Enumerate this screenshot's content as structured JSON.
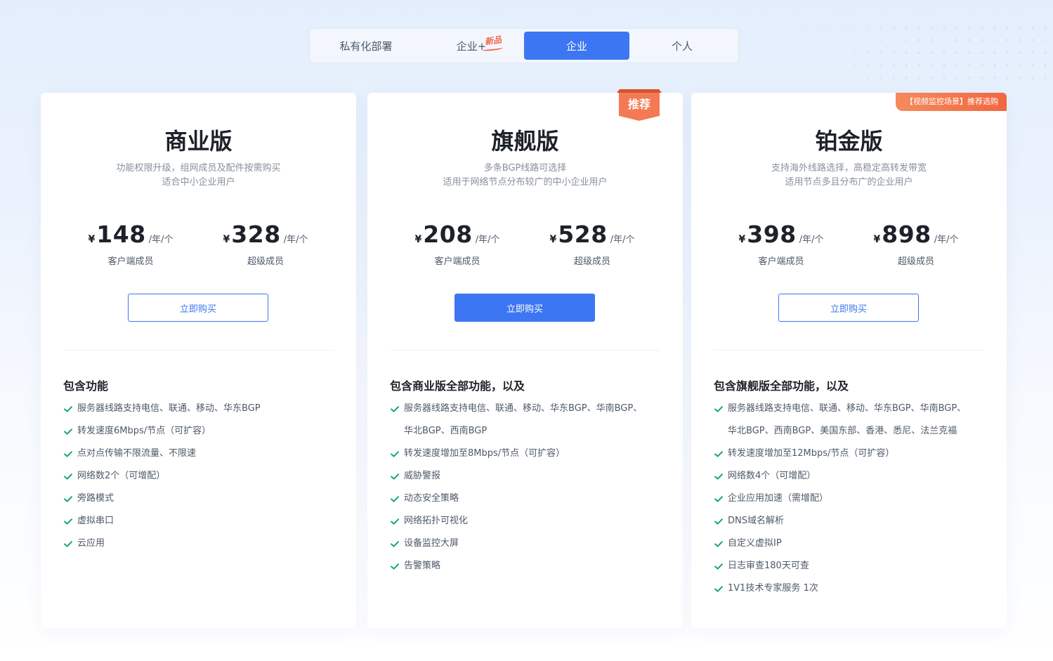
{
  "tabs": [
    {
      "label": "私有化部署"
    },
    {
      "label": "企业+",
      "badge": "新品"
    },
    {
      "label": "企业"
    },
    {
      "label": "个人"
    }
  ],
  "active_tab": "企业",
  "colors": {
    "accent": "#3c76f2",
    "badge": "#f2694a",
    "check": "#1aa36a"
  },
  "plans": [
    {
      "title": "商业版",
      "desc": [
        "功能权限升级，组网成员及配件按需购买",
        "适合中小企业用户"
      ],
      "prices": [
        {
          "currency": "¥",
          "amount": "148",
          "unit": "/年/个",
          "label": "客户端成员"
        },
        {
          "currency": "¥",
          "amount": "328",
          "unit": "/年/个",
          "label": "超级成员"
        }
      ],
      "buy_label": "立即购买",
      "features_title": "包含功能",
      "features": [
        "服务器线路支持电信、联通、移动、华东BGP",
        "转发速度6Mbps/节点（可扩容）",
        "点对点传输不限流量、不限速",
        "网络数2个（可增配）",
        "旁路模式",
        "虚拟串口",
        "云应用"
      ]
    },
    {
      "title": "旗舰版",
      "badge": "推荐",
      "desc": [
        "多条BGP线路可选择",
        "适用于网络节点分布较广的中小企业用户"
      ],
      "prices": [
        {
          "currency": "¥",
          "amount": "208",
          "unit": "/年/个",
          "label": "客户端成员"
        },
        {
          "currency": "¥",
          "amount": "528",
          "unit": "/年/个",
          "label": "超级成员"
        }
      ],
      "buy_label": "立即购买",
      "features_title": "包含商业版全部功能，以及",
      "features": [
        "服务器线路支持电信、联通、移动、华东BGP、华南BGP、",
        "华北BGP、西南BGP",
        "转发速度增加至8Mbps/节点（可扩容）",
        "威胁警报",
        "动态安全策略",
        "网络拓扑可视化",
        "设备监控大屏",
        "告警策略"
      ]
    },
    {
      "title": "铂金版",
      "badge": "【视频监控场景】推荐选购",
      "desc": [
        "支持海外线路选择，高稳定高转发带宽",
        "适用节点多且分布广的企业用户"
      ],
      "prices": [
        {
          "currency": "¥",
          "amount": "398",
          "unit": "/年/个",
          "label": "客户端成员"
        },
        {
          "currency": "¥",
          "amount": "898",
          "unit": "/年/个",
          "label": "超级成员"
        }
      ],
      "buy_label": "立即购买",
      "features_title": "包含旗舰版全部功能，以及",
      "features": [
        "服务器线路支持电信、联通、移动、华东BGP、华南BGP、",
        "华北BGP、西南BGP、美国东部、香港、悉尼、法兰克福",
        "转发速度增加至12Mbps/节点（可扩容）",
        "网络数4个（可增配）",
        "企业应用加速（需增配）",
        "DNS域名解析",
        "自定义虚拟IP",
        "日志审查180天可查",
        "1V1技术专家服务 1次"
      ]
    }
  ]
}
